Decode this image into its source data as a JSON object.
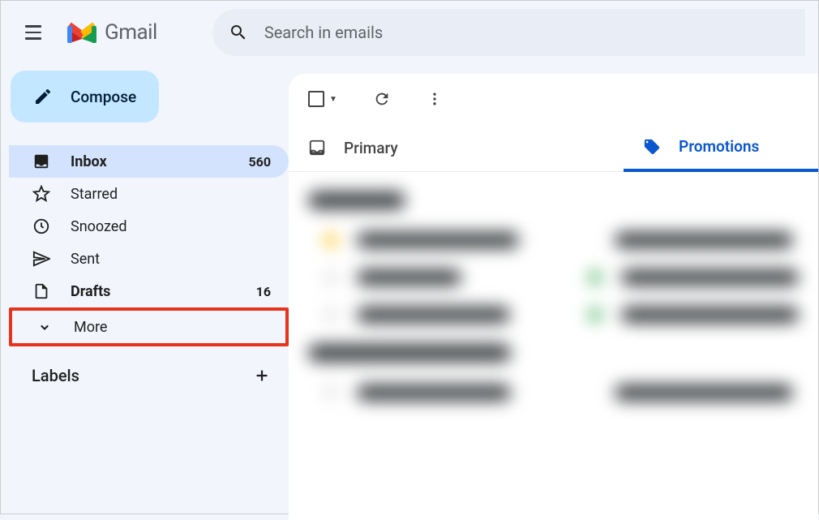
{
  "header": {
    "appName": "Gmail",
    "searchPlaceholder": "Search in emails"
  },
  "compose": {
    "label": "Compose"
  },
  "sidebar": {
    "items": [
      {
        "label": "Inbox",
        "count": "560"
      },
      {
        "label": "Starred",
        "count": ""
      },
      {
        "label": "Snoozed",
        "count": ""
      },
      {
        "label": "Sent",
        "count": ""
      },
      {
        "label": "Drafts",
        "count": "16"
      },
      {
        "label": "More",
        "count": ""
      }
    ],
    "labelsHeader": "Labels"
  },
  "tabs": {
    "primary": "Primary",
    "promotions": "Promotions"
  }
}
